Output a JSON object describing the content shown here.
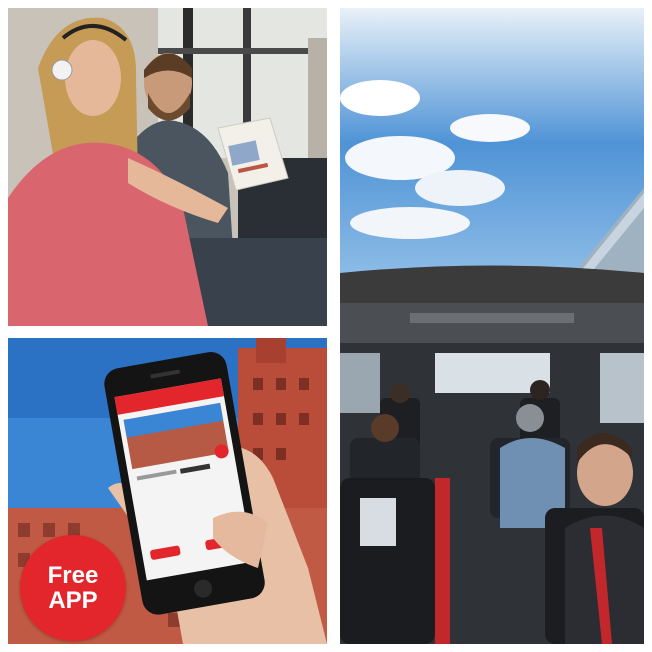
{
  "badge": {
    "line1": "Free",
    "line2": "APP"
  },
  "colors": {
    "brand_red": "#e2262b",
    "sky_blue": "#3a86d4",
    "building_red": "#b94d3a"
  },
  "tiles": {
    "top_left": "passengers-with-headphones-reading-brochure",
    "right": "open-top-bus-interior-with-glass-roof",
    "bottom_left": "hand-holding-phone-with-app"
  }
}
